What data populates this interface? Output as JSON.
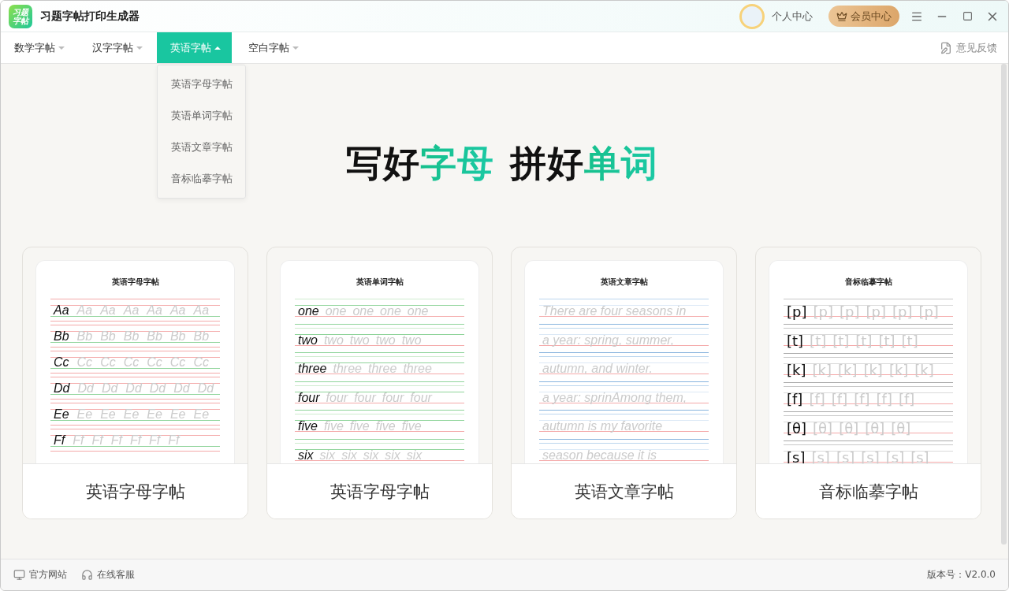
{
  "titlebar": {
    "logo": [
      "习题",
      "字帖"
    ],
    "title": "习题字帖打印生成器",
    "user": "个人中心",
    "vip": "会员中心"
  },
  "nav": {
    "tabs": [
      {
        "label": "数学字帖",
        "selected": false,
        "expanded": false
      },
      {
        "label": "汉字字帖",
        "selected": false,
        "expanded": false
      },
      {
        "label": "英语字帖",
        "selected": true,
        "expanded": true
      },
      {
        "label": "空白字帖",
        "selected": false,
        "expanded": false
      }
    ],
    "dropdown": [
      "英语字母字帖",
      "英语单词字帖",
      "英语文章字帖",
      "音标临摹字帖"
    ],
    "feedback": "意见反馈"
  },
  "hero": [
    {
      "plain": "写好",
      "accent": "字母"
    },
    {
      "plain": "拼好",
      "accent": "单词"
    }
  ],
  "cards": [
    {
      "title": "英语字母字帖",
      "kind": "letters",
      "caption": "英语字母字帖",
      "rows": [
        {
          "model": "Aa",
          "traces": [
            "Aa",
            "Aa",
            "Aa",
            "Aa",
            "Aa",
            "Aa"
          ]
        },
        {
          "model": "Bb",
          "traces": [
            "Bb",
            "Bb",
            "Bb",
            "Bb",
            "Bb",
            "Bb"
          ]
        },
        {
          "model": "Cc",
          "traces": [
            "Cc",
            "Cc",
            "Cc",
            "Cc",
            "Cc",
            "Cc"
          ]
        },
        {
          "model": "Dd",
          "traces": [
            "Dd",
            "Dd",
            "Dd",
            "Dd",
            "Dd",
            "Dd"
          ]
        },
        {
          "model": "Ee",
          "traces": [
            "Ee",
            "Ee",
            "Ee",
            "Ee",
            "Ee",
            "Ee"
          ]
        },
        {
          "model": "Ff",
          "traces": [
            "Ff",
            "Ff",
            "Ff",
            "Ff",
            "Ff",
            "Ff"
          ]
        }
      ]
    },
    {
      "title": "英语单词字帖",
      "kind": "words",
      "caption": "英语字母字帖",
      "rows": [
        {
          "model": "one",
          "traces": [
            "one",
            "one",
            "one",
            "one"
          ]
        },
        {
          "model": "two",
          "traces": [
            "two",
            "two",
            "two",
            "two"
          ]
        },
        {
          "model": "three",
          "traces": [
            "three",
            "three",
            "three"
          ]
        },
        {
          "model": "four",
          "traces": [
            "four",
            "four",
            "four",
            "four"
          ]
        },
        {
          "model": "five",
          "traces": [
            "five",
            "five",
            "five",
            "five"
          ]
        },
        {
          "model": "six",
          "traces": [
            "six",
            "six",
            "six",
            "six",
            "six"
          ]
        }
      ]
    },
    {
      "title": "英语文章字帖",
      "kind": "article",
      "caption": "英语文章字帖",
      "rows": [
        {
          "traces": [
            "There are four seasons in"
          ]
        },
        {
          "traces": [
            "a year: spring, summer,"
          ]
        },
        {
          "traces": [
            "autumn, and winter."
          ]
        },
        {
          "traces": [
            "a year: sprinAmong them,"
          ]
        },
        {
          "traces": [
            "autumn is my favorite"
          ]
        },
        {
          "traces": [
            "season because it is"
          ]
        }
      ]
    },
    {
      "title": "音标临摹字帖",
      "kind": "phonetic",
      "caption": "音标临摹字帖",
      "rows": [
        {
          "model": "[p]",
          "traces": [
            "[p]",
            "[p]",
            "[p]",
            "[p]",
            "[p]"
          ]
        },
        {
          "model": "[t]",
          "traces": [
            "[t]",
            "[t]",
            "[t]",
            "[t]",
            "[t]"
          ]
        },
        {
          "model": "[k]",
          "traces": [
            "[k]",
            "[k]",
            "[k]",
            "[k]",
            "[k]"
          ]
        },
        {
          "model": "[f]",
          "traces": [
            "[f]",
            "[f]",
            "[f]",
            "[f]",
            "[f]"
          ]
        },
        {
          "model": "[θ]",
          "traces": [
            "[θ]",
            "[θ]",
            "[θ]",
            "[θ]"
          ]
        },
        {
          "model": "[s]",
          "traces": [
            "[s]",
            "[s]",
            "[s]",
            "[s]",
            "[s]"
          ]
        }
      ]
    }
  ],
  "footer": {
    "links": [
      {
        "label": "官方网站",
        "kind": "website"
      },
      {
        "label": "在线客服",
        "kind": "support"
      }
    ],
    "version": "版本号：V2.0.0"
  }
}
